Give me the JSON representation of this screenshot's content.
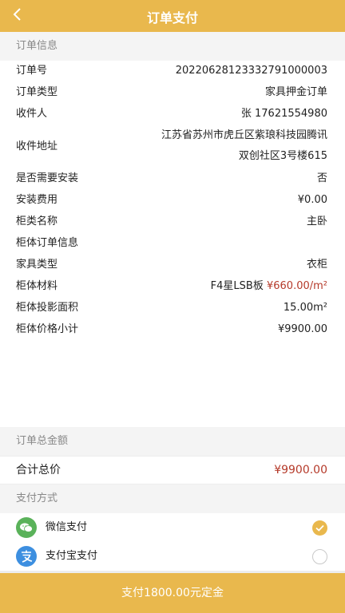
{
  "header": {
    "title": "订单支付"
  },
  "order_info": {
    "section_title": "订单信息",
    "rows": [
      {
        "label": "订单号",
        "value": "20220628123332791000003"
      },
      {
        "label": "订单类型",
        "value": "家具押金订单"
      },
      {
        "label": "收件人",
        "value": "张 17621554980"
      },
      {
        "label": "收件地址",
        "value_line1": "江苏省苏州市虎丘区紫琅科技园腾讯",
        "value_line2": "双创社区3号楼615"
      },
      {
        "label": "是否需要安装",
        "value": "否"
      },
      {
        "label": "安装费用",
        "value": "¥0.00"
      },
      {
        "label": "柜类名称",
        "value": "主卧"
      },
      {
        "label": "柜体订单信息",
        "value": ""
      },
      {
        "label": "家具类型",
        "value": "衣柜"
      },
      {
        "label": "柜体材料",
        "value_prefix": "F4星LSB板",
        "value": "¥660.00/m²"
      },
      {
        "label": "柜体投影面积",
        "value": "15.00m²"
      },
      {
        "label": "柜体价格小计",
        "value": "¥9900.00"
      }
    ]
  },
  "order_total": {
    "section_title": "订单总金额",
    "label": "合计总价",
    "value": "¥9900.00"
  },
  "payment": {
    "section_title": "支付方式",
    "methods": [
      {
        "label": "微信支付",
        "icon": "wechat-icon",
        "selected": true
      },
      {
        "label": "支付宝支付",
        "icon": "alipay-icon",
        "selected": false
      }
    ]
  },
  "pay_button": {
    "label": "支付1800.00元定金"
  },
  "colors": {
    "accent": "#e9b84d",
    "price_red": "#b53a2a",
    "wechat": "#5ab25a",
    "alipay": "#3d8fe0"
  }
}
